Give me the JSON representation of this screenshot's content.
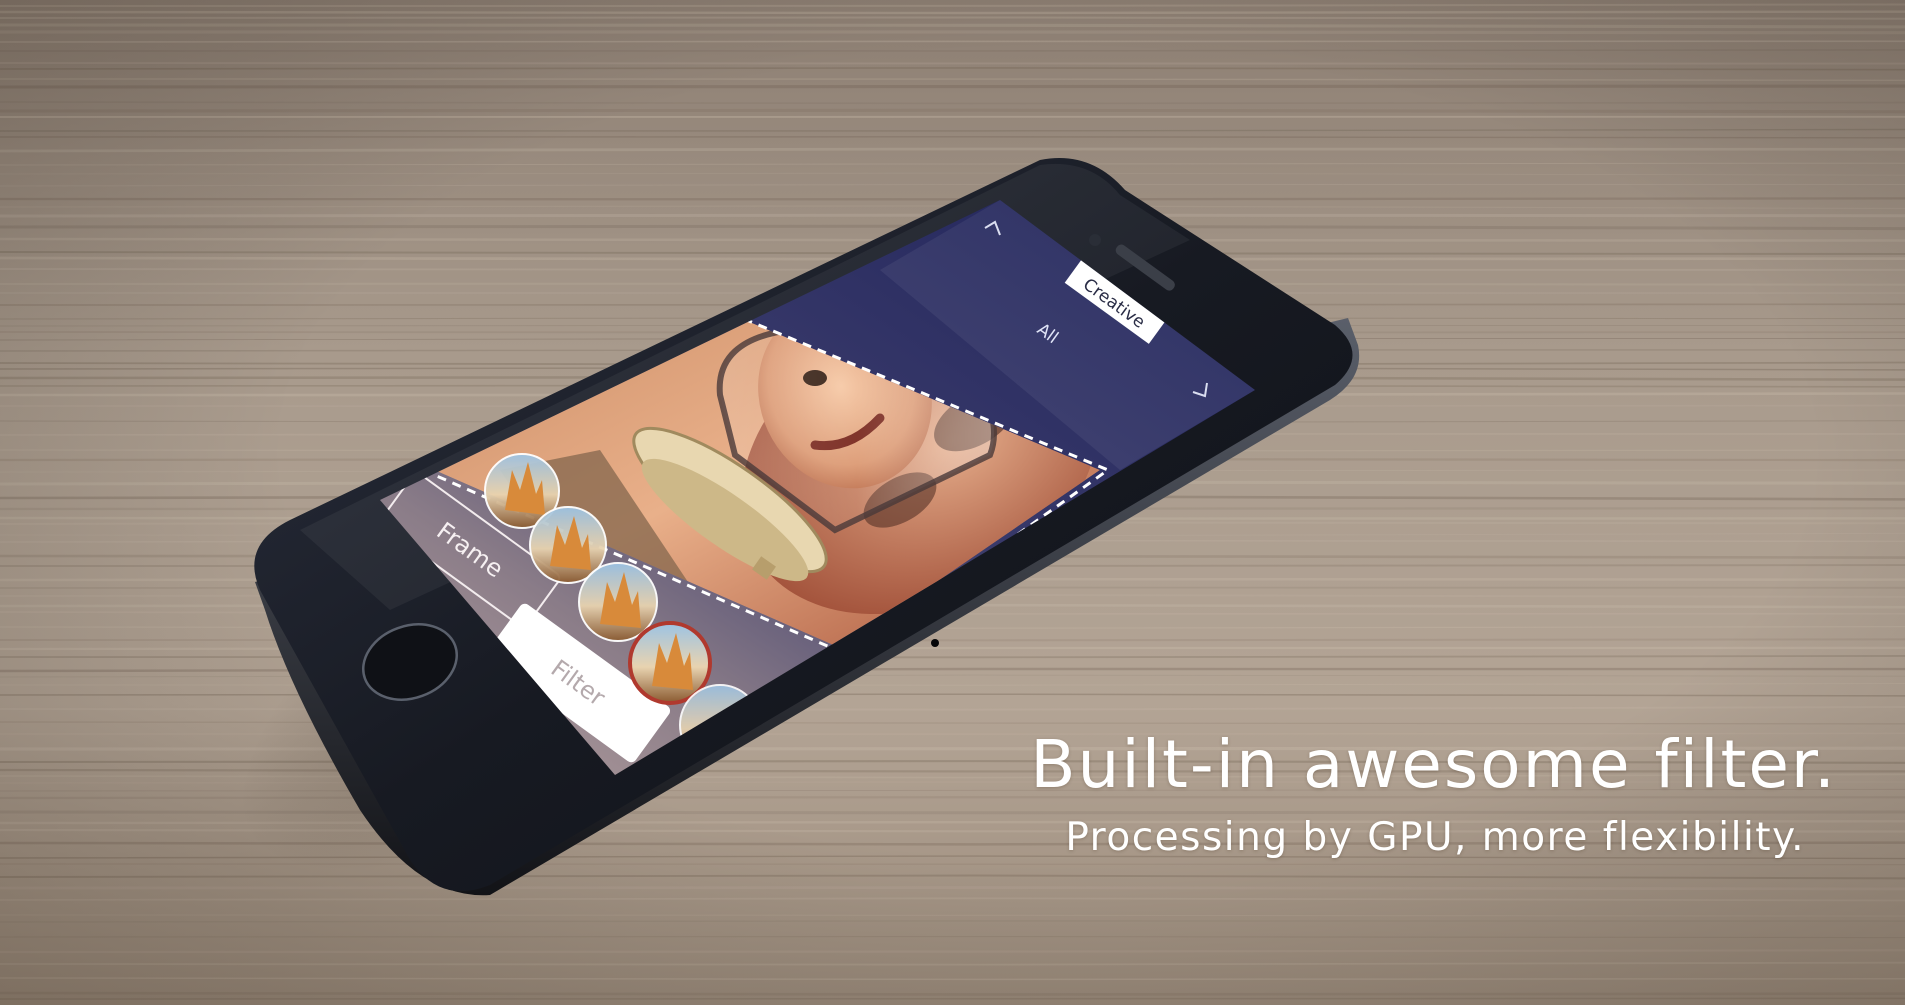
{
  "caption": {
    "headline": "Built-in awesome filter.",
    "subline": "Processing by GPU, more flexibility."
  },
  "app_screen": {
    "category_tabs": [
      "Creative",
      "All"
    ],
    "mode_buttons": {
      "frame": "Frame",
      "filter": "Filter",
      "active": "Filter"
    },
    "filter_thumbnail_count": 4,
    "selected_thumbnail": 4
  },
  "colors": {
    "screen_top": "#23275a",
    "screen_bottom": "#a99799",
    "phone_body": "#1c1f28",
    "wood": "#a8998a",
    "filter_button": "#ffffff",
    "selected_ring": "#b0392e"
  }
}
